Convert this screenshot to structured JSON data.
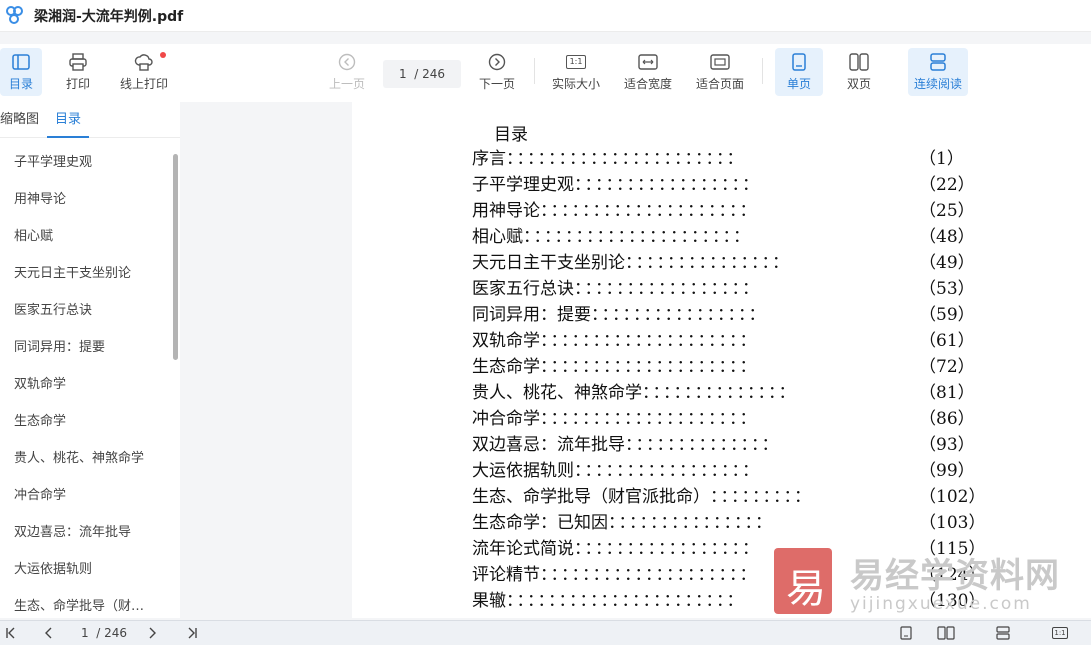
{
  "window": {
    "title": "梁湘润-大流年判例.pdf"
  },
  "toolbar": {
    "toc": "目录",
    "print": "打印",
    "online_print": "线上打印",
    "prev": "上一页",
    "page_current": "1",
    "page_total": "/ 246",
    "next": "下一页",
    "actual_size": "实际大小",
    "fit_width": "适合宽度",
    "fit_page": "适合页面",
    "single": "单页",
    "double": "双页",
    "continuous": "连续阅读",
    "actual_size_icon_text": "1:1"
  },
  "sidebar": {
    "tabs": [
      "缩略图",
      "目录"
    ],
    "items": [
      "子平学理史观",
      "用神导论",
      "相心赋",
      "天元日主干支坐别论",
      "医家五行总诀",
      "同词异用：提要",
      "双轨命学",
      "生态命学",
      "贵人、桃花、神煞命学",
      "冲合命学",
      "双边喜忌：流年批导",
      "大运依据轨则",
      "生态、命学批导（财…"
    ]
  },
  "document": {
    "heading": "目录",
    "entries": [
      {
        "title": "序言",
        "dots": "：：：：：：：：：：：：：：：：：：：：：：",
        "page": "（1）"
      },
      {
        "title": "子平学理史观",
        "dots": "：：：：：：：：：：：：：：：：：",
        "page": "（22）"
      },
      {
        "title": "用神导论",
        "dots": "：：：：：：：：：：：：：：：：：：：：",
        "page": "（25）"
      },
      {
        "title": "相心赋",
        "dots": "：：：：：：：：：：：：：：：：：：：：：",
        "page": "（48）"
      },
      {
        "title": "天元日主干支坐别论",
        "dots": "：：：：：：：：：：：：：：：",
        "page": "（49）"
      },
      {
        "title": "医家五行总诀",
        "dots": "：：：：：：：：：：：：：：：：：",
        "page": "（53）"
      },
      {
        "title": "同词异用：提要",
        "dots": "：：：：：：：：：：：：：：：：",
        "page": "（59）"
      },
      {
        "title": "双轨命学",
        "dots": "：：：：：：：：：：：：：：：：：：：：",
        "page": "（61）"
      },
      {
        "title": "生态命学",
        "dots": "：：：：：：：：：：：：：：：：：：：：",
        "page": "（72）"
      },
      {
        "title": "贵人、桃花、神煞命学",
        "dots": "：：：：：：：：：：：：：：",
        "page": "（81）"
      },
      {
        "title": "冲合命学",
        "dots": "：：：：：：：：：：：：：：：：：：：：",
        "page": "（86）"
      },
      {
        "title": "双边喜忌：流年批导",
        "dots": "：：：：：：：：：：：：：：",
        "page": "（93）"
      },
      {
        "title": "大运依据轨则",
        "dots": "：：：：：：：：：：：：：：：：：",
        "page": "（99）"
      },
      {
        "title": "生态、命学批导（财官派批命）",
        "dots": "：：：：：：：：：",
        "page": "（102）"
      },
      {
        "title": "生态命学：已知因",
        "dots": "：：：：：：：：：：：：：：：",
        "page": "（103）"
      },
      {
        "title": "流年论式简说",
        "dots": "：：：：：：：：：：：：：：：：：",
        "page": "（115）"
      },
      {
        "title": "评论精节",
        "dots": "：：：：：：：：：：：：：：：：：：：：",
        "page": "（124）"
      },
      {
        "title": "果辙",
        "dots": "：：：：：：：：：：：：：：：：：：：：：：",
        "page": "（130）"
      }
    ]
  },
  "watermark": {
    "brand": "易经学资料网",
    "domain": "yijingxuexue.com"
  },
  "statusbar": {
    "page_current": "1",
    "page_total": "/ 246",
    "zoom_icon_text": "1:1"
  },
  "colors": {
    "accent": "#2a7fd6",
    "active_bg": "#e6f1fc",
    "notify": "#f04848"
  }
}
